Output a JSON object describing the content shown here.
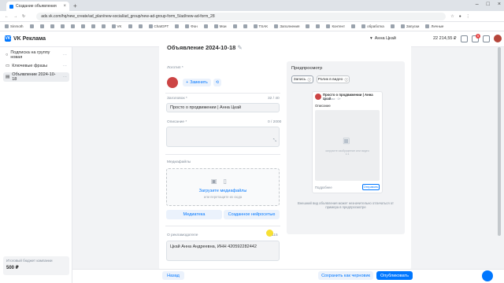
{
  "browser": {
    "tab_title": "Создание объявления",
    "url": "ads.vk.com/hq/new_create/ad_plan/new-social/ad_group/new-ad-group-form_5/ad/new-ad-form_28",
    "bookmarks": [
      "Sinmoth",
      "",
      "",
      "",
      "",
      "",
      "",
      "",
      "",
      "VK",
      "",
      "",
      "ChatGPT",
      "",
      "Фон",
      "",
      "Мои",
      "",
      "",
      "TSAK",
      "Заполнения",
      "",
      "",
      "Контент",
      "",
      "обработка",
      "",
      "Запуски",
      "Личные"
    ]
  },
  "app": {
    "brand": "VK Реклама",
    "account": "Анна Цкай",
    "balance": "22 214,55 ₽",
    "notif_count": "5"
  },
  "sidebar": {
    "items": [
      {
        "label": "Подписка на группу новая"
      },
      {
        "label": "Ключевые фразы"
      },
      {
        "label": "Объявление 2024-10-18"
      }
    ],
    "budget_label": "Итоговый бюджет кампании",
    "budget_value": "500 ₽"
  },
  "form": {
    "title": "Объявление 2024-10-18",
    "logo_label": "Логотип *",
    "replace_label": "Заменить",
    "headline_label": "Заголовок *",
    "headline_count": "32 / 40",
    "headline_value": "Просто о продвижении | Анна Цкай",
    "desc_label": "Описание *",
    "desc_count": "0 / 2000",
    "media_label": "Медиафайлы",
    "upload_label": "Загрузите медиафайлы",
    "upload_hint": "или перетащите их сюда",
    "media_library": "Медиатека",
    "create_ai": "Созданное нейросетью",
    "advertiser_label": "О рекламодателе",
    "advertiser_count": "115",
    "advertiser_value": "Цкай Анна Андреевна, ИНН 420592282442"
  },
  "preview": {
    "title": "Предпросмотр",
    "tab_post": "Запись",
    "tab_video": "Ролик в видео",
    "card_title": "Просто о продвижении | Анна Цкай",
    "card_sub": "Реклама · 0+",
    "card_desc": "Описание",
    "img_caption": "загрузите изображение или видео 1:1",
    "learn_more": "Подробнее",
    "cta": "Отправить",
    "note": "Внешний вид объявления может незначительно отличаться от примера в предпросмотре"
  },
  "footer": {
    "back": "Назад",
    "draft": "Сохранить как черновик",
    "publish": "Опубликовать"
  },
  "colors": {
    "accent": "#0077ff",
    "bg": "#f2f3f5"
  }
}
